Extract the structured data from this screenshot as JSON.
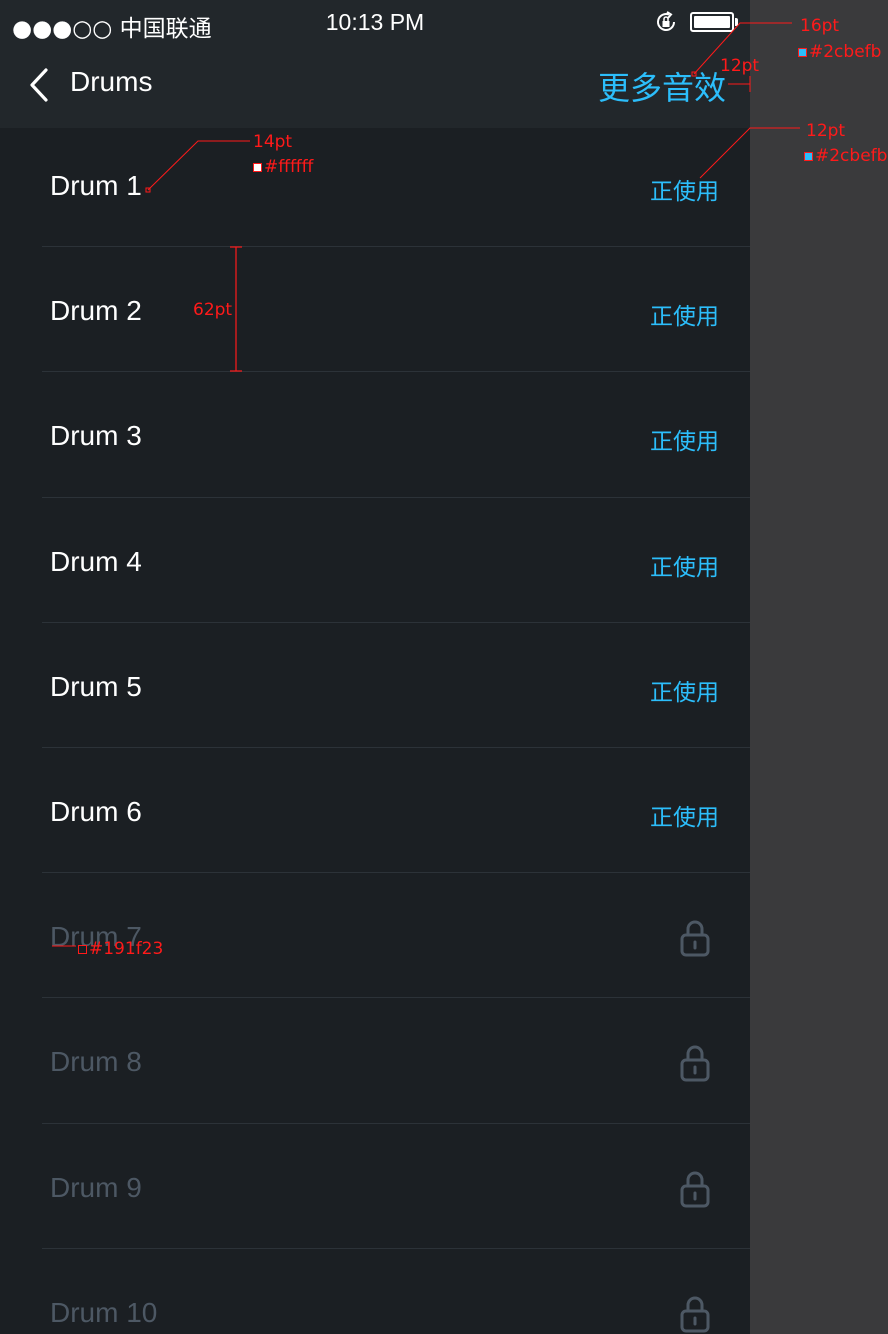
{
  "status_bar": {
    "carrier": "●●●○○ 中国联通",
    "time": "10:13 PM"
  },
  "nav": {
    "title": "Drums",
    "more_label": "更多音效"
  },
  "items": [
    {
      "label": "Drum 1",
      "action": "正使用",
      "locked": false
    },
    {
      "label": "Drum 2",
      "action": "正使用",
      "locked": false
    },
    {
      "label": "Drum 3",
      "action": "正使用",
      "locked": false
    },
    {
      "label": "Drum 4",
      "action": "正使用",
      "locked": false
    },
    {
      "label": "Drum 5",
      "action": "正使用",
      "locked": false
    },
    {
      "label": "Drum 6",
      "action": "正使用",
      "locked": false
    },
    {
      "label": "Drum 7",
      "locked": true
    },
    {
      "label": "Drum 8",
      "locked": true
    },
    {
      "label": "Drum 9",
      "locked": true
    },
    {
      "label": "Drum 10",
      "locked": true
    }
  ],
  "annotations": {
    "a1_size": "16pt",
    "a1_color": "#2cbefb",
    "a2_size": "12pt",
    "a3_size": "14pt",
    "a3_color": "#ffffff",
    "a4_size": "12pt",
    "a4_color": "#2cbefb",
    "a5_height": "62pt",
    "a6_color": "#191f23"
  },
  "colors": {
    "accent": "#2cbefb",
    "background": "#1b1f23",
    "header": "#22272b",
    "locked_text": "#4d5864",
    "side_panel": "#3a3a3c",
    "annotation": "#ff1a1a"
  }
}
